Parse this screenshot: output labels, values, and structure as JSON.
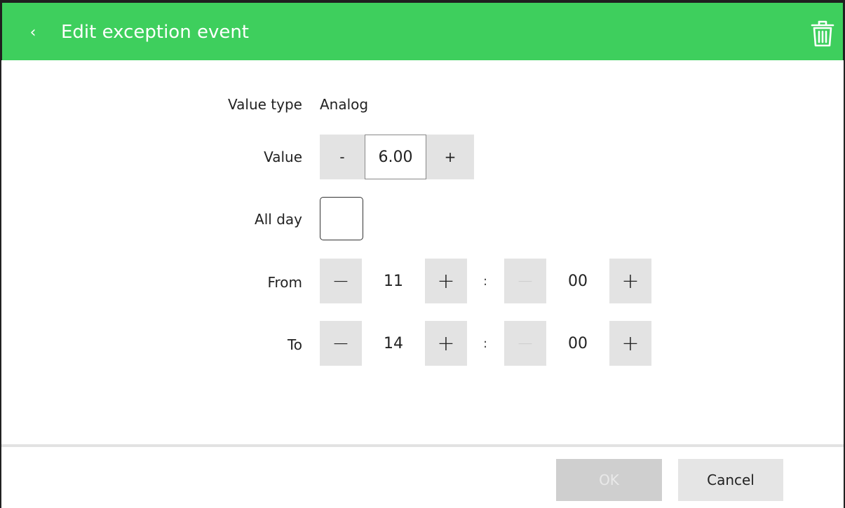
{
  "header": {
    "back_glyph": "‹",
    "title": "Edit exception event",
    "delete_icon": "trash-icon",
    "color": "#3ecf5d"
  },
  "form": {
    "value_type_label": "Value type",
    "value_type_value": "Analog",
    "value_label": "Value",
    "value": "6.00",
    "value_minus": "-",
    "value_plus": "+",
    "all_day_label": "All day",
    "all_day_checked": false,
    "from_label": "From",
    "from_hour": "11",
    "from_minute": "00",
    "to_label": "To",
    "to_hour": "14",
    "to_minute": "00",
    "minus_glyph": "−",
    "plus_glyph": "+",
    "separator": ":"
  },
  "footer": {
    "ok_label": "OK",
    "cancel_label": "Cancel"
  }
}
